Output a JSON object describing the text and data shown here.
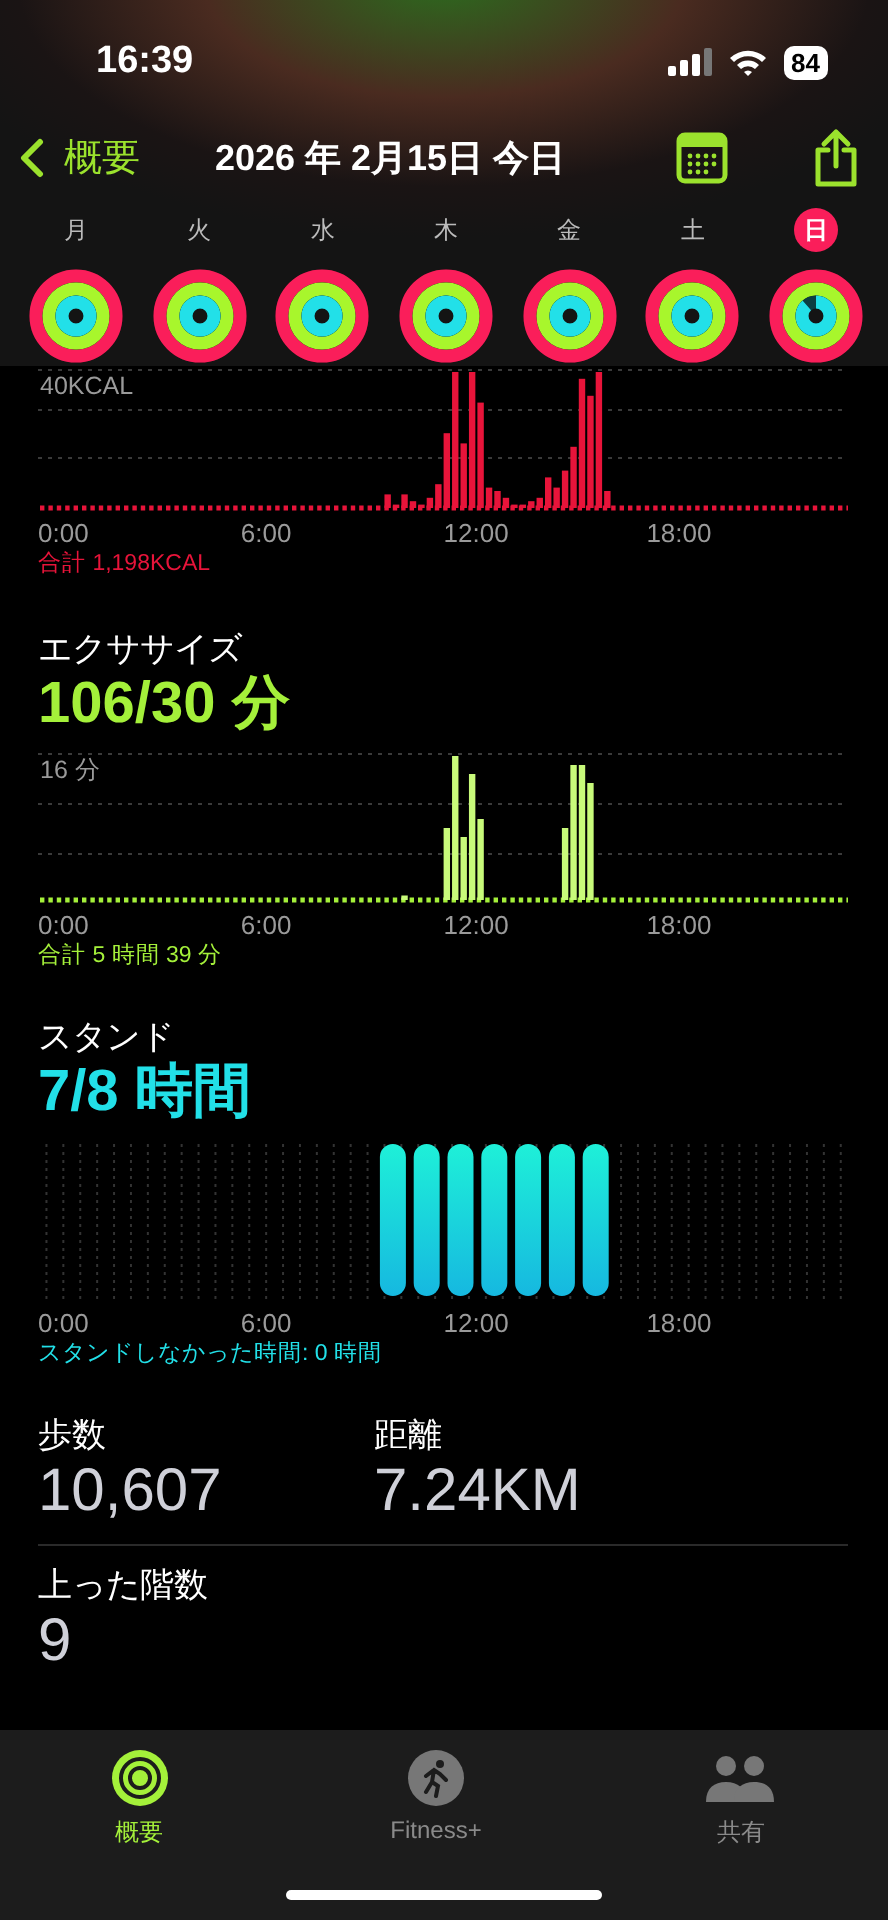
{
  "status_bar": {
    "time": "16:39",
    "battery": "84"
  },
  "nav": {
    "back": "概要",
    "title": "2026 年 2月15日 今日"
  },
  "week": [
    {
      "day": "月",
      "selected": false,
      "rings": [
        {
          "kind": "move",
          "level": 1
        },
        {
          "kind": "exercise",
          "level": 1
        },
        {
          "kind": "stand",
          "level": 1
        }
      ]
    },
    {
      "day": "火",
      "selected": false,
      "rings": [
        {
          "kind": "move",
          "level": 1
        },
        {
          "kind": "exercise",
          "level": 1
        },
        {
          "kind": "stand",
          "level": 1
        }
      ]
    },
    {
      "day": "水",
      "selected": false,
      "rings": [
        {
          "kind": "move",
          "level": 1
        },
        {
          "kind": "exercise",
          "level": 1
        },
        {
          "kind": "stand",
          "level": 1
        }
      ]
    },
    {
      "day": "木",
      "selected": false,
      "rings": [
        {
          "kind": "move",
          "level": 1
        },
        {
          "kind": "exercise",
          "level": 1
        },
        {
          "kind": "stand",
          "level": 1
        }
      ]
    },
    {
      "day": "金",
      "selected": false,
      "rings": [
        {
          "kind": "move",
          "level": 1
        },
        {
          "kind": "exercise",
          "level": 1
        },
        {
          "kind": "stand",
          "level": 1
        }
      ]
    },
    {
      "day": "土",
      "selected": false,
      "rings": [
        {
          "kind": "move",
          "level": 1
        },
        {
          "kind": "exercise",
          "level": 1
        },
        {
          "kind": "stand",
          "level": 1
        }
      ]
    },
    {
      "day": "日",
      "selected": true,
      "rings": [
        {
          "kind": "move",
          "level": 1
        },
        {
          "kind": "exercise",
          "level": 1
        },
        {
          "kind": "stand",
          "level": 0.88
        }
      ]
    }
  ],
  "move": {
    "y_label": "40KCAL",
    "x_labels": [
      "0:00",
      "6:00",
      "12:00",
      "18:00"
    ],
    "total": "合計 1,198KCAL"
  },
  "exercise": {
    "title": "エクササイズ",
    "value": "106/30 分",
    "y_label": "16 分",
    "x_labels": [
      "0:00",
      "6:00",
      "12:00",
      "18:00"
    ],
    "total": "合計 5 時間 39 分"
  },
  "stand": {
    "title": "スタンド",
    "value": "7/8 時間",
    "x_labels": [
      "0:00",
      "6:00",
      "12:00",
      "18:00"
    ],
    "total": "スタンドしなかった時間: 0 時間"
  },
  "stats": [
    {
      "label": "歩数",
      "value": "10,607"
    },
    {
      "label": "距離",
      "value": "7.24KM"
    }
  ],
  "floors": {
    "label": "上った階数",
    "value": "9"
  },
  "tabs": [
    {
      "kind": "summary",
      "label": "概要",
      "selected": true
    },
    {
      "kind": "fitness",
      "label": "Fitness+",
      "selected": false
    },
    {
      "kind": "sharing",
      "label": "共有",
      "selected": false
    }
  ]
}
